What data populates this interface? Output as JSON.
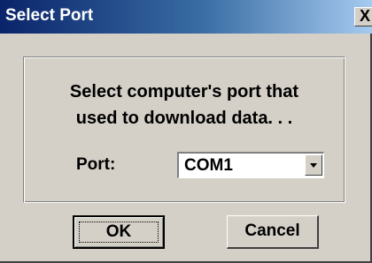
{
  "window": {
    "title": "Select Port",
    "close_glyph": "X"
  },
  "dialog": {
    "message": "Select computer's port that used to download data. . .",
    "port_label": "Port:",
    "port_value": "COM1"
  },
  "buttons": {
    "ok": "OK",
    "cancel": "Cancel"
  },
  "colors": {
    "face": "#d4d0c8",
    "title_start": "#0a246a",
    "title_end": "#a6caf0"
  },
  "icons": {
    "close": "close-icon",
    "dropdown": "chevron-down-icon"
  }
}
